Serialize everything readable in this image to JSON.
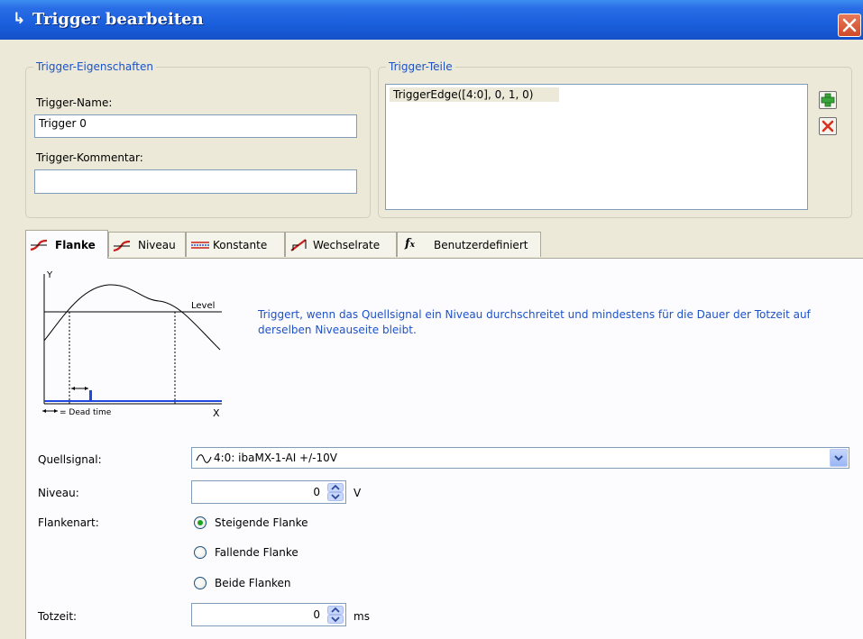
{
  "window": {
    "title": "Trigger bearbeiten",
    "title_icon": "arrow-return-icon"
  },
  "properties": {
    "group_label": "Trigger-Eigenschaften",
    "name_label": "Trigger-Name:",
    "name_value": "Trigger 0",
    "comment_label": "Trigger-Kommentar:",
    "comment_value": ""
  },
  "parts": {
    "group_label": "Trigger-Teile",
    "items": [
      "TriggerEdge([4:0], 0, 1, 0)"
    ]
  },
  "tabs": [
    {
      "label": "Flanke",
      "icon": "edge-icon",
      "active": true
    },
    {
      "label": "Niveau",
      "icon": "level-icon",
      "active": false
    },
    {
      "label": "Konstante",
      "icon": "constant-icon",
      "active": false
    },
    {
      "label": "Wechselrate",
      "icon": "rate-icon",
      "active": false
    },
    {
      "label": "Benutzerdefiniert",
      "icon": "function-icon",
      "active": false
    }
  ],
  "diagram": {
    "y_label": "Y",
    "x_label": "X",
    "level_label": "Level",
    "dead_time_label": "= Dead time"
  },
  "description": "Triggert, wenn das Quellsignal ein Niveau durchschreitet und mindestens für die Dauer der Totzeit auf derselben Niveauseite bleibt.",
  "form": {
    "source_label": "Quellsignal:",
    "source_value": "4:0: ibaMX-1-AI +/-10V",
    "level_label": "Niveau:",
    "level_value": "0",
    "level_unit": "V",
    "edge_type_label": "Flankenart:",
    "edge_options": [
      {
        "label": "Steigende Flanke",
        "checked": true
      },
      {
        "label": "Fallende Flanke",
        "checked": false
      },
      {
        "label": "Beide Flanken",
        "checked": false
      }
    ],
    "dead_time_label": "Totzeit:",
    "dead_time_value": "0",
    "dead_time_unit": "ms"
  },
  "colors": {
    "titlebar": "#1a5fdc",
    "accent_blue": "#1c52c8",
    "signal_blue": "#1f48e0",
    "radio_checked": "#21a121"
  }
}
